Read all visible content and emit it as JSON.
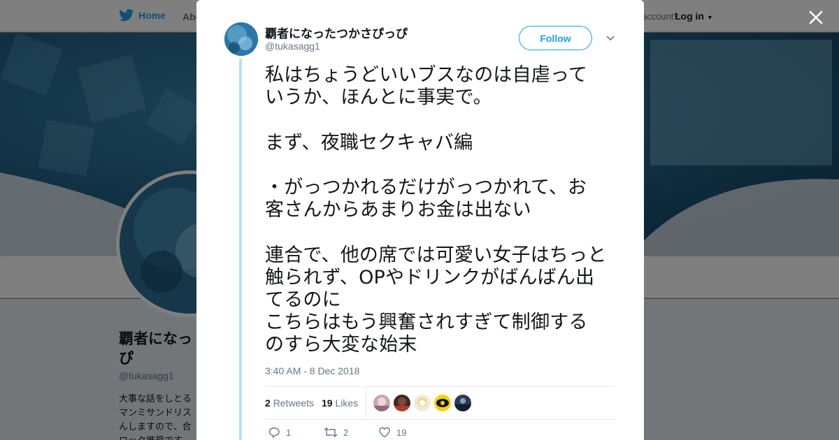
{
  "background_page": {
    "nav": {
      "home_label": "Home",
      "about_label": "Abo",
      "account_prompt": "account?",
      "login_label": "Log in"
    },
    "profile": {
      "name": "覇者になっ\nぴ",
      "handle": "@tukasagg1",
      "bio": "大事な話をしとる\nマンミサンドリス\nんしますので、合\nロック推奨です"
    }
  },
  "modal": {
    "close_label": "Close",
    "user": {
      "display_name": "覇者になったつかさぴっぴ",
      "handle": "@tukasagg1"
    },
    "follow_label": "Follow",
    "tweet_text": "私はちょうどいいブスなのは自虐って\nいうか、ほんとに事実で。\n\nまず、夜職セクキャバ編\n\n・がっつかれるだけがっつかれて、お\n客さんからあまりお金は出ない\n\n連合で、他の席では可愛い女子はちっと\n触られず、OPやドリンクがばんばん出\nてるのに\nこちらはもう興奮されすぎて制御する\nのすら大変な始末",
    "timestamp": "3:40 AM - 8 Dec 2018",
    "stats": {
      "retweets_count": "2",
      "retweets_label": "Retweets",
      "likes_count": "19",
      "likes_label": "Likes"
    },
    "actions": {
      "reply_count": "1",
      "retweet_count": "2",
      "like_count": "19"
    }
  },
  "colors": {
    "accent": "#1da1f2",
    "thread_line": "#b7dff7",
    "text": "#14171a",
    "muted": "#657786"
  }
}
